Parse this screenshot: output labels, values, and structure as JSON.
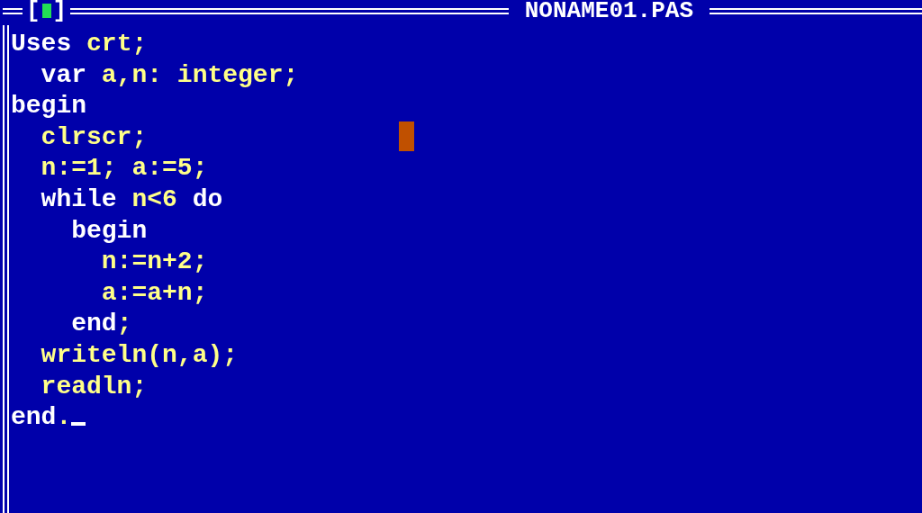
{
  "window": {
    "title": "NONAME01.PAS",
    "close_box": {
      "open": "[",
      "close": "]"
    }
  },
  "editor": {
    "lines": [
      {
        "tokens": [
          {
            "kind": "keyword",
            "text": "Uses"
          },
          {
            "kind": "plain",
            "text": " crt;"
          }
        ],
        "cursor": false
      },
      {
        "tokens": [
          {
            "kind": "keyword",
            "text": "  var"
          },
          {
            "kind": "plain",
            "text": " a,n: integer;"
          }
        ],
        "cursor": false
      },
      {
        "tokens": [
          {
            "kind": "keyword",
            "text": "begin"
          }
        ],
        "cursor": false
      },
      {
        "tokens": [
          {
            "kind": "plain",
            "text": "  clrscr;"
          }
        ],
        "cursor": false
      },
      {
        "tokens": [
          {
            "kind": "plain",
            "text": "  n:=1; a:=5;"
          }
        ],
        "cursor": false
      },
      {
        "tokens": [
          {
            "kind": "keyword",
            "text": "  while"
          },
          {
            "kind": "plain",
            "text": " n<6 "
          },
          {
            "kind": "keyword",
            "text": "do"
          }
        ],
        "cursor": false
      },
      {
        "tokens": [
          {
            "kind": "keyword",
            "text": "    begin"
          }
        ],
        "cursor": false
      },
      {
        "tokens": [
          {
            "kind": "plain",
            "text": "      n:=n+2;"
          }
        ],
        "cursor": false
      },
      {
        "tokens": [
          {
            "kind": "plain",
            "text": "      a:=a+n;"
          }
        ],
        "cursor": false
      },
      {
        "tokens": [
          {
            "kind": "keyword",
            "text": "    end"
          },
          {
            "kind": "plain",
            "text": ";"
          }
        ],
        "cursor": false
      },
      {
        "tokens": [
          {
            "kind": "plain",
            "text": "  writeln(n,a);"
          }
        ],
        "cursor": false
      },
      {
        "tokens": [
          {
            "kind": "plain",
            "text": "  readln;"
          }
        ],
        "cursor": false
      },
      {
        "tokens": [
          {
            "kind": "keyword",
            "text": "end"
          },
          {
            "kind": "plain",
            "text": "."
          }
        ],
        "cursor": true
      }
    ]
  }
}
